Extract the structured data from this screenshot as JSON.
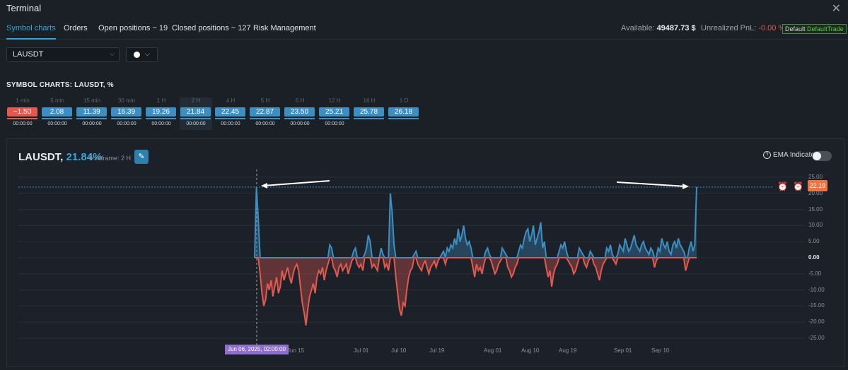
{
  "window": {
    "title": "Terminal",
    "close_glyph": "✕"
  },
  "nav": {
    "tabs": [
      "Symbol charts",
      "Orders",
      "Open positions ~ 19",
      "Closed positions ~ 127",
      "Risk Management"
    ],
    "available_label": "Available:",
    "available_value": "49487.73 $",
    "unrealized_label": "Unrealized PnL:",
    "unrealized_value": "-0.00 %",
    "profile_label": "Default",
    "profile_value": "DefaultTrade"
  },
  "controls": {
    "symbol": "LAUSDT",
    "color_picker_icon": "white-dot-icon"
  },
  "heading": "SYMBOL CHARTS: LAUSDT, %",
  "timeframes": [
    {
      "label": "1 min",
      "value": "−1.50",
      "time": "00:00:00",
      "negative": true
    },
    {
      "label": "5 min",
      "value": "2.08",
      "time": "00:00:00",
      "negative": false
    },
    {
      "label": "15 min",
      "value": "11.39",
      "time": "00:00:00",
      "negative": false
    },
    {
      "label": "30 min",
      "value": "16.39",
      "time": "00:00:00",
      "negative": false
    },
    {
      "label": "1 H",
      "value": "19.26",
      "time": "00:00:00",
      "negative": false
    },
    {
      "label": "2 H",
      "value": "21.84",
      "time": "00:00:00",
      "negative": false,
      "selected": true
    },
    {
      "label": "4 H",
      "value": "22.45",
      "time": "00:00:00",
      "negative": false
    },
    {
      "label": "5 H",
      "value": "22.87",
      "time": "00:00:00",
      "negative": false
    },
    {
      "label": "6 H",
      "value": "23.50",
      "time": "00:00:00",
      "negative": false
    },
    {
      "label": "12 H",
      "value": "25.21",
      "time": "00:00:00",
      "negative": false
    },
    {
      "label": "16 H",
      "value": "25.78",
      "time": "",
      "negative": false
    },
    {
      "label": "1 D",
      "value": "26.18",
      "time": "",
      "negative": false
    }
  ],
  "panel": {
    "symbol": "LAUSDT,",
    "percent": "21.84%",
    "timeframe_text": "timeframe: 2 H",
    "ema_label": "EMA Indicator",
    "price_tag": "22.19",
    "crosshair_label": "Jun 06, 2025, 02:00:00"
  },
  "colors": {
    "positive": "#3c8fc0",
    "negative": "#e05a4f",
    "accent": "#3aa3d8",
    "tag": "#f0743c"
  },
  "chart_data": {
    "type": "area",
    "y_ticks": [
      "25.00",
      "20.00",
      "15.00",
      "10.00",
      "5.00",
      "0.00",
      "-5.00",
      "-10.00",
      "-15.00",
      "-20.00",
      "-25.00"
    ],
    "x_ticks": [
      "Jun 15",
      "Jul 01",
      "Jul 10",
      "Jul 19",
      "Aug 01",
      "Aug 10",
      "Aug 19",
      "Sep 01",
      "Sep 10"
    ],
    "ylim": [
      -26,
      26
    ],
    "reference_line": 22.19,
    "grid": true,
    "series": [
      {
        "values": [
          0,
          22,
          12,
          -5,
          -11,
          -15,
          -13,
          -8,
          -10,
          -7,
          -12,
          -9,
          -6,
          -11,
          -9,
          -4,
          -7,
          -5,
          -3,
          -6,
          -8,
          -5,
          -3,
          -2,
          -4,
          -9,
          -14,
          -17,
          -21,
          -16,
          -12,
          -10,
          -8,
          -11,
          -6,
          -4,
          -5,
          -3,
          -7,
          -4,
          -2,
          4,
          3,
          -3,
          -4,
          -6,
          -3,
          -2,
          -4,
          -3,
          -2,
          -5,
          -3,
          -1,
          2,
          3,
          -2,
          -3,
          -2,
          -4,
          1,
          3,
          7,
          5,
          -3,
          -2,
          -3,
          -4,
          0,
          3,
          1,
          -3,
          -2,
          -4,
          20,
          14,
          4,
          -6,
          -11,
          -16,
          -18,
          -14,
          -15,
          -10,
          -6,
          -4,
          -3,
          1,
          2,
          -2,
          -3,
          -4,
          -2,
          -1,
          -3,
          -5,
          -3,
          -2,
          -1,
          -3,
          -1,
          0,
          1,
          2,
          -2,
          3,
          2,
          4,
          3,
          6,
          4,
          9,
          5,
          7,
          10,
          6,
          4,
          5,
          3,
          -3,
          -6,
          -2,
          -4,
          -3,
          -5,
          -2,
          2,
          3,
          1,
          -1,
          -3,
          -5,
          -4,
          -2,
          -1,
          3,
          2,
          1,
          -3,
          -4,
          -6,
          -5,
          -3,
          -2,
          2,
          4,
          3,
          6,
          8,
          9,
          5,
          7,
          10,
          4,
          6,
          8,
          11,
          3,
          5,
          -3,
          -6,
          -4,
          -9,
          -5,
          -3,
          -2,
          2,
          4,
          3,
          5,
          2,
          -1,
          -2,
          -3,
          -5,
          -4,
          -2,
          3,
          2,
          1,
          -2,
          -3,
          -1,
          2,
          1,
          -2,
          -3,
          -5,
          -7,
          -4,
          -2,
          -1,
          3,
          2,
          4,
          1,
          -1,
          -2,
          1,
          4,
          3,
          2,
          6,
          4,
          2,
          3,
          5,
          7,
          4,
          3,
          2,
          4,
          5,
          3,
          2,
          1,
          3,
          2,
          -3,
          -1,
          3,
          2,
          6,
          4,
          3,
          5,
          2,
          1,
          4,
          5,
          3,
          6,
          4,
          3,
          2,
          -4,
          -2,
          3,
          5,
          2,
          4,
          22
        ]
      }
    ]
  }
}
